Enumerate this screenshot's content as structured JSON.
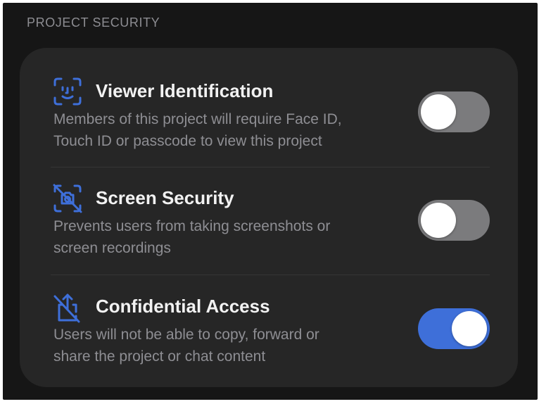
{
  "section": {
    "header": "PROJECT SECURITY"
  },
  "colors": {
    "accent": "#3e6fd9",
    "background": "#161616",
    "card": "#262626",
    "toggle_off": "#7b7b7d"
  },
  "settings": [
    {
      "title": "Viewer Identification",
      "description_line1": "Members of this project will require Face ID,",
      "description_line2": "Touch ID or passcode to view this project",
      "icon": "face-id-icon",
      "enabled": false
    },
    {
      "title": "Screen Security",
      "description_line1": "Prevents users from taking screenshots or",
      "description_line2": "screen recordings",
      "icon": "screenshot-blocked-icon",
      "enabled": false
    },
    {
      "title": "Confidential Access",
      "description_line1": "Users will not be able to copy, forward or",
      "description_line2": "share the project or chat content",
      "icon": "share-blocked-icon",
      "enabled": true
    }
  ]
}
